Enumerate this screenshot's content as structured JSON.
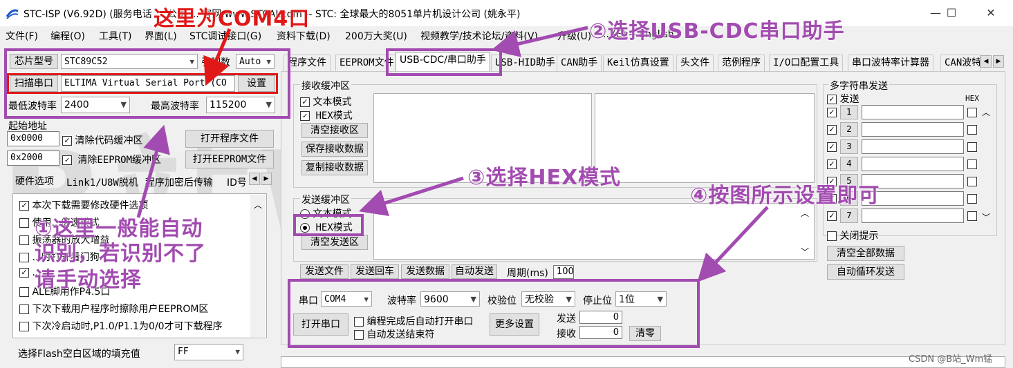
{
  "titlebar": {
    "title": "STC-ISP (V6.92D) (服务电话 ... 公司 ... 官网:www.STCAI.com  -- STC: 全球最大的8051单片机设计公司 (姚永平)",
    "minimize": "—",
    "maximize": "☐",
    "close": "✕"
  },
  "menu": [
    "文件(F)",
    "编程(O)",
    "工具(T)",
    "界面(L)",
    "STC调试接口(G)",
    "资料下载(D)",
    "200万大奖(U)",
    "视频教学/技术论坛/资料(V)",
    "升级(U)",
    "...(E) -- English"
  ],
  "left": {
    "chip_label": "芯片型号",
    "chip_value": "STC89C52",
    "pin_label": "引脚数",
    "pin_value": "Auto",
    "scan_label": "扫描串口",
    "port_value": "ELTIMA Virtual Serial Port (CO",
    "settings_label": "设置",
    "min_baud_label": "最低波特率",
    "min_baud_value": "2400",
    "max_baud_label": "最高波特率",
    "max_baud_value": "115200",
    "start_addr_label": "起始地址",
    "addr1": "0x0000",
    "clear_code_label": "清除代码缓冲区",
    "open_prog_label": "打开程序文件",
    "addr2": "0x2000",
    "clear_eeprom_label": "清除EEPROM缓冲区",
    "open_eeprom_label": "打开EEPROM文件",
    "subtabs": [
      "硬件选项",
      "Link1/U8W脱机",
      "程序加密后传输",
      "ID号"
    ],
    "options": [
      {
        "text": "本次下载需要修改硬件选项",
        "checked": true
      },
      {
        "text": "使用...倍速模式",
        "checked": false
      },
      {
        "text": "振荡器的放大增益",
        "checked": false
      },
      {
        "text": "...时打开看门狗...",
        "checked": false
      },
      {
        "text": "...",
        "checked": true
      },
      {
        "text": "ALE脚用作P4.5口",
        "checked": false
      },
      {
        "text": "下次下载用户程序时擦除用户EEPROM区",
        "checked": false
      },
      {
        "text": "下次冷启动时,P1.0/P1.1为0/0才可下载程序",
        "checked": false
      }
    ],
    "flash_fill_label": "选择Flash空白区域的填充值",
    "flash_fill_value": "FF"
  },
  "tabs": [
    "程序文件",
    "EEPROM文件",
    "USB-CDC/串口助手",
    "USB-HID助手",
    "CAN助手",
    "Keil仿真设置",
    "头文件",
    "范例程序",
    "I/O口配置工具",
    "串口波特率计算器",
    "CAN波特"
  ],
  "receive": {
    "group_label": "接收缓冲区",
    "text_mode": "文本模式",
    "hex_mode": "HEX模式",
    "clear_label": "清空接收区",
    "save_label": "保存接收数据",
    "copy_label": "复制接收数据"
  },
  "send": {
    "group_label": "发送缓冲区",
    "text_mode": "文本模式",
    "hex_mode": "HEX模式",
    "clear_label": "清空发送区",
    "send_file": "发送文件",
    "send_return": "发送回车",
    "send_data": "发送数据",
    "auto_send": "自动发送",
    "period_label": "周期(ms)",
    "period_value": "100"
  },
  "multi": {
    "title": "多字符串发送",
    "send_header": "发送",
    "hex_header": "HEX",
    "rows": [
      "1",
      "2",
      "3",
      "4",
      "5",
      "6",
      "7"
    ],
    "close_tip": "关闭提示",
    "clear_all": "清空全部数据",
    "auto_loop": "自动循环发送"
  },
  "serial": {
    "port_label": "串口",
    "port_value": "COM4",
    "baud_label": "波特率",
    "baud_value": "9600",
    "parity_label": "校验位",
    "parity_value": "无校验",
    "stop_label": "停止位",
    "stop_value": "1位",
    "open_label": "打开串口",
    "auto_open": "编程完成后自动打开串口",
    "auto_end": "自动发送结束符",
    "more_label": "更多设置",
    "send_label": "发送",
    "send_count": "0",
    "recv_label": "接收",
    "recv_count": "0",
    "clear_label": "清零"
  },
  "annotations": {
    "com4": "这里为COM4口",
    "step1": "①这里一般能自动",
    "step1b": "识别，若识别不了",
    "step1c": "请手动选择",
    "step2": "②选择USB-CDC串口助手",
    "step3": "③选择HEX模式",
    "step4": "④按图所示设置即可",
    "credit": "CSDN @B站_Wm锰"
  },
  "watermark": "B站Wm锰",
  "colors": {
    "annotation_purple": "#a24bb0",
    "annotation_red": "#e01818"
  }
}
